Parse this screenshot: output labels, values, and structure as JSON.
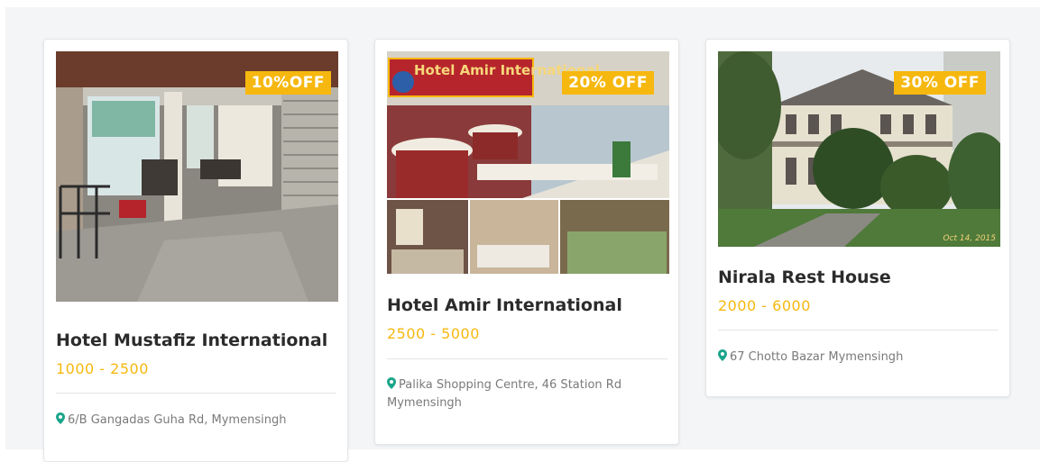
{
  "colors": {
    "accent": "#f6b80f",
    "pin": "#1aa58b",
    "title": "#2b2b2b",
    "muted": "#7a7a7a"
  },
  "hotels": [
    {
      "name": "Hotel Mustafiz International",
      "price": "1000 - 2500",
      "discount": "10%OFF",
      "address": "6/B Gangadas Guha Rd, Mymensingh"
    },
    {
      "name": "Hotel Amir International",
      "price": "2500 - 5000",
      "discount": "20% OFF",
      "address": "Palika Shopping Centre, 46 Station Rd Mymensingh",
      "photo_sign": "Hotel Amir International"
    },
    {
      "name": "Nirala Rest House",
      "price": "2000 - 6000",
      "discount": "30% OFF",
      "address": "67 Chotto Bazar Mymensingh",
      "photo_date": "Oct 14, 2015"
    }
  ]
}
